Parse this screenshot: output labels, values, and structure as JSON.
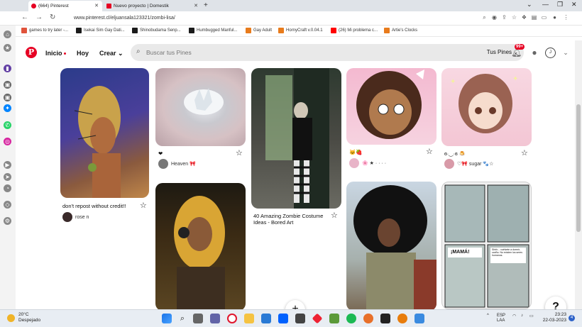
{
  "browser": {
    "tabs": [
      {
        "label": "(664) Pinterest",
        "active": true
      },
      {
        "label": "Nuevo proyecto | Domestik",
        "active": false
      }
    ],
    "url": "www.pinterest.cl/eljuansala123321/zombi-lisa/",
    "bookmarks": [
      "games to try later -...",
      "Isekai Sim Gay Dati...",
      "Shinobudama Senp...",
      "Humbugged Manful...",
      "Gay Adult",
      "HornyCraft v.0.04.1",
      "(26) Mi problema c...",
      "Artie's Clocks"
    ]
  },
  "pinterest": {
    "nav": {
      "home": "Inicio",
      "today": "Hoy",
      "create": "Crear"
    },
    "search_placeholder": "Buscar tus Pines",
    "your_pins": "Tus Pines",
    "notif_count": "99+",
    "avatar_initial": "J",
    "pins": [
      {
        "caption": "don't repost without credit!!",
        "user": "rose n"
      },
      {
        "caption": "❤",
        "user": "Heaven 🎀"
      },
      {
        "caption": "40 Amazing Zombie Costume Ideas - Bored Art",
        "user": ""
      },
      {
        "caption": "🐱🍓",
        "user": "🌸 ★ · · · ·"
      },
      {
        "caption": "ɞ·‿·ɞ 🍮",
        "user": "♡🎀 sugar 🐾☆"
      },
      {
        "caption": "",
        "user": ""
      },
      {
        "caption": "",
        "user": ""
      },
      {
        "caption": "",
        "user": ""
      },
      {
        "caption": "",
        "user": ""
      }
    ],
    "comic_text_1": "¡MAMÁ!",
    "comic_text_2": "Shhh... vuélvete a dormir, cariño. No existen los seres humanos."
  },
  "taskbar": {
    "weather_temp": "20°C",
    "weather_desc": "Despejado",
    "lang": "ESP",
    "lang2": "LAA",
    "time": "23:23",
    "date": "22-03-2023",
    "notif": "4"
  },
  "colors": {
    "brand": "#e60023"
  }
}
